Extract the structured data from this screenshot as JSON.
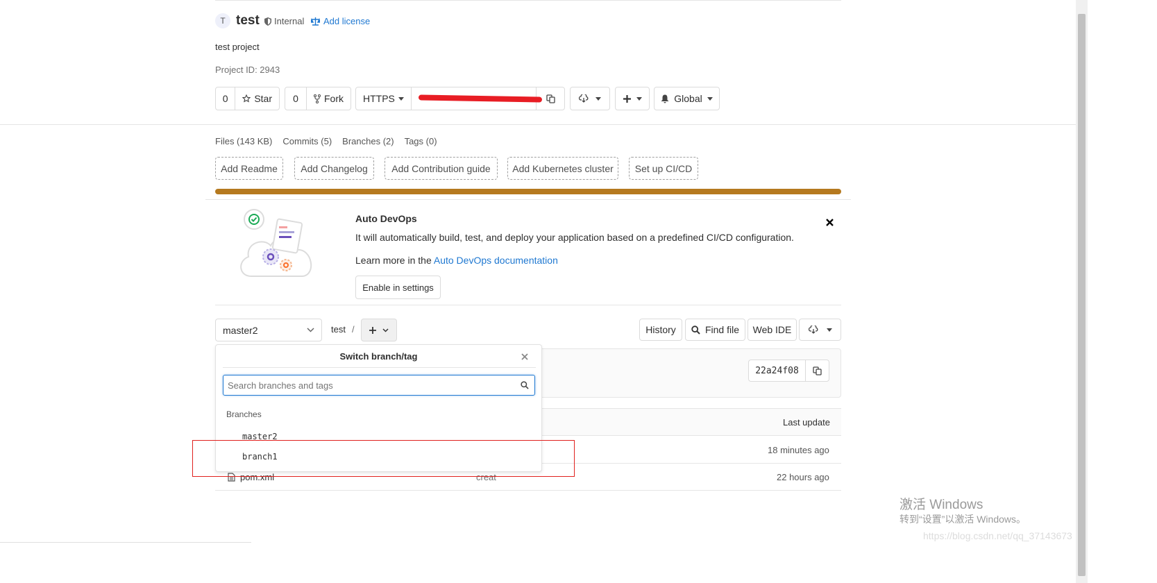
{
  "project": {
    "avatar_letter": "T",
    "name": "test",
    "visibility": "Internal",
    "add_license": "Add license",
    "description": "test project",
    "project_id": "Project ID: 2943"
  },
  "actions": {
    "star_count": "0",
    "star_label": "Star",
    "fork_count": "0",
    "fork_label": "Fork",
    "clone_protocol": "HTTPS",
    "notification_label": "Global"
  },
  "stats": {
    "files": "Files (143 KB)",
    "commits": "Commits (5)",
    "branches": "Branches (2)",
    "tags": "Tags (0)"
  },
  "quick_actions": [
    "Add Readme",
    "Add Changelog",
    "Add Contribution guide",
    "Add Kubernetes cluster",
    "Set up CI/CD"
  ],
  "autodevops": {
    "title": "Auto DevOps",
    "description": "It will automatically build, test, and deploy your application based on a predefined CI/CD configuration.",
    "learn_more_prefix": "Learn more in the",
    "learn_more_link": "Auto DevOps documentation",
    "enable_button": "Enable in settings"
  },
  "repo_nav": {
    "current_branch": "master2",
    "path_root": "test",
    "path_separator": "/",
    "history": "History",
    "find_file": "Find file",
    "web_ide": "Web IDE"
  },
  "commit": {
    "sha": "22a24f08"
  },
  "table": {
    "last_update_header": "Last update",
    "rows": [
      {
        "name": "",
        "message": "",
        "updated": "18 minutes ago"
      },
      {
        "name": "pom.xml",
        "message": "creat",
        "updated": "22 hours ago"
      }
    ]
  },
  "branch_dropdown": {
    "title": "Switch branch/tag",
    "search_placeholder": "Search branches and tags",
    "section_label": "Branches",
    "branches": [
      "master2",
      "branch1"
    ]
  },
  "watermark": {
    "line1": "激活 Windows",
    "line2": "转到“设置”以激活 Windows。",
    "url": "https://blog.csdn.net/qq_37143673"
  },
  "colors": {
    "progress": "#b5791f",
    "link": "#1f78d1",
    "highlight_box": "#e0201d",
    "redaction": "#e81d24"
  }
}
